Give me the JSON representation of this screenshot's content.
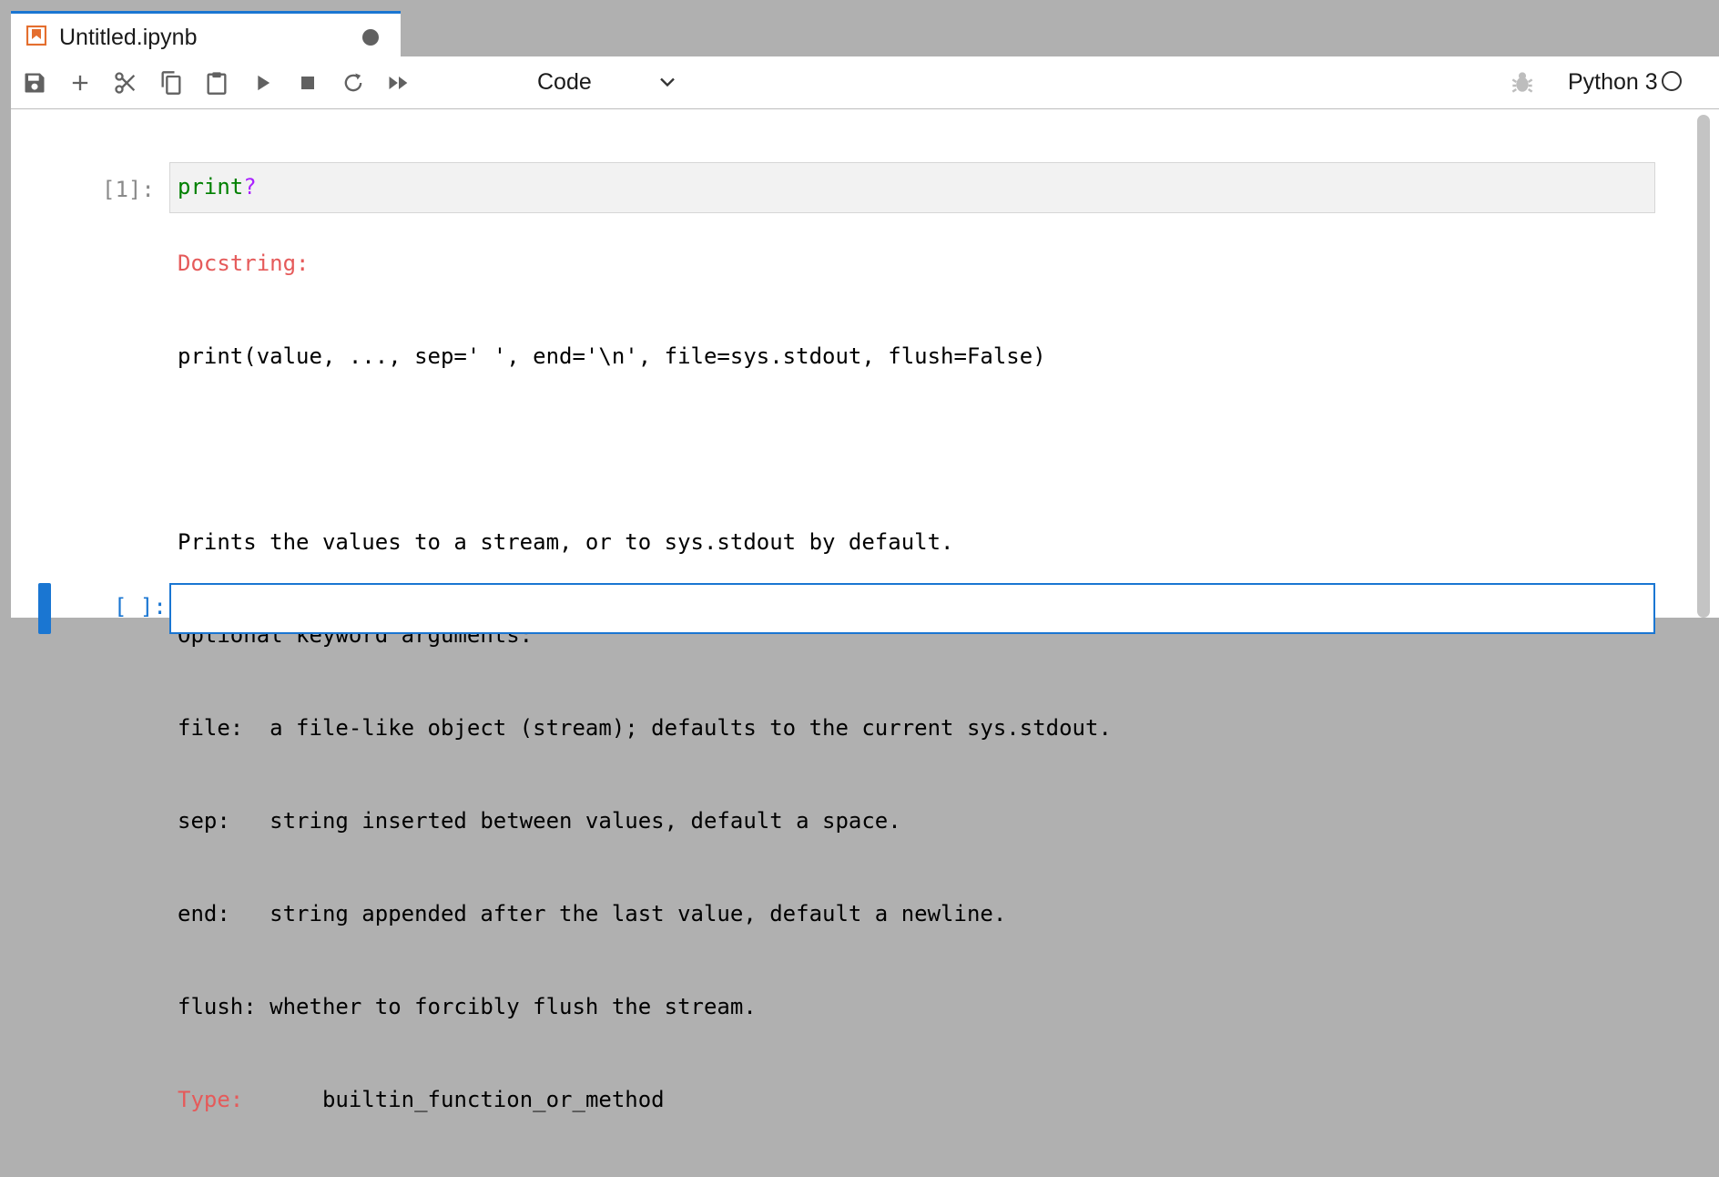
{
  "tab": {
    "title": "Untitled.ipynb",
    "icon": "notebook-icon",
    "dirty": true
  },
  "toolbar": {
    "buttons": [
      "save-icon",
      "plus-icon",
      "cut-icon",
      "copy-icon",
      "paste-icon",
      "run-icon",
      "stop-icon",
      "restart-icon",
      "fast-forward-icon"
    ],
    "cell_type": "Code",
    "kernel_name": "Python 3",
    "kernel_status": "idle"
  },
  "cells": [
    {
      "prompt": "[1]:",
      "code": {
        "func": "print",
        "op": "?"
      },
      "output": {
        "docstring_label": "Docstring:",
        "signature": "print(value, ..., sep=' ', end='\\n', file=sys.stdout, flush=False)",
        "lines": [
          "Prints the values to a stream, or to sys.stdout by default.",
          "Optional keyword arguments:",
          "file:  a file-like object (stream); defaults to the current sys.stdout.",
          "sep:   string inserted between values, default a space.",
          "end:   string appended after the last value, default a newline.",
          "flush: whether to forcibly flush the stream."
        ],
        "type_label": "Type:",
        "type_value": "builtin_function_or_method"
      }
    },
    {
      "prompt": "[ ]:",
      "code": ""
    }
  ],
  "colors": {
    "accent": "#1a76d2",
    "label_red": "#e55a5a",
    "code_green": "#008000",
    "code_purple": "#aa22ff"
  }
}
